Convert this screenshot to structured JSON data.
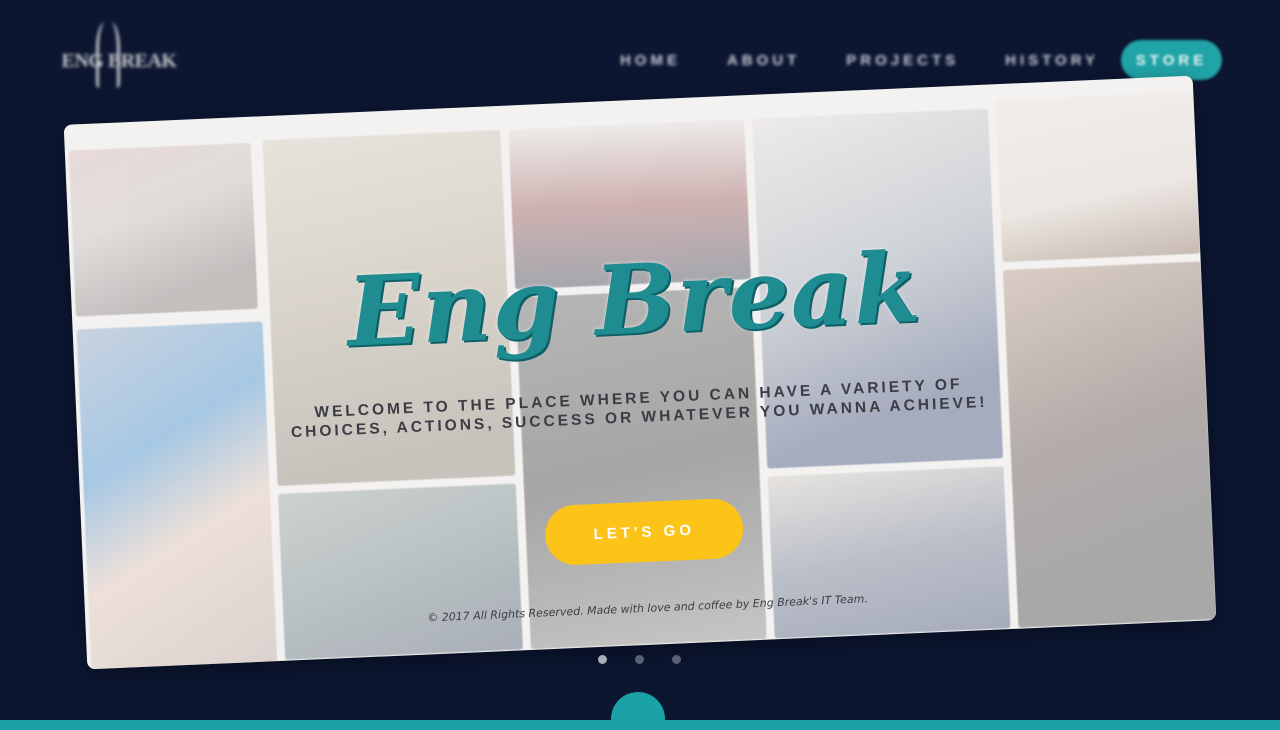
{
  "brand": {
    "logo_text": "ENG BREAK"
  },
  "nav": {
    "items": [
      "HOME",
      "ABOUT",
      "PROJECTS",
      "HISTORY"
    ],
    "store_label": "STORE"
  },
  "hero": {
    "title": "Eng Break",
    "subtitle_line1": "WELCOME TO THE PLACE WHERE YOU CAN HAVE A VARIETY OF",
    "subtitle_line2": "CHOICES, ACTIONS, SUCCESS OR WHATEVER YOU WANNA ACHIEVE!",
    "cta_label": "LET'S GO",
    "copyright": "© 2017 All Rights Reserved. Made with love and coffee by Eng Break's IT Team."
  },
  "slider": {
    "count": 3,
    "active_index": 0
  },
  "colors": {
    "background": "#0c1631",
    "accent_teal": "#1aa2a6",
    "cta_yellow": "#fcc319"
  }
}
